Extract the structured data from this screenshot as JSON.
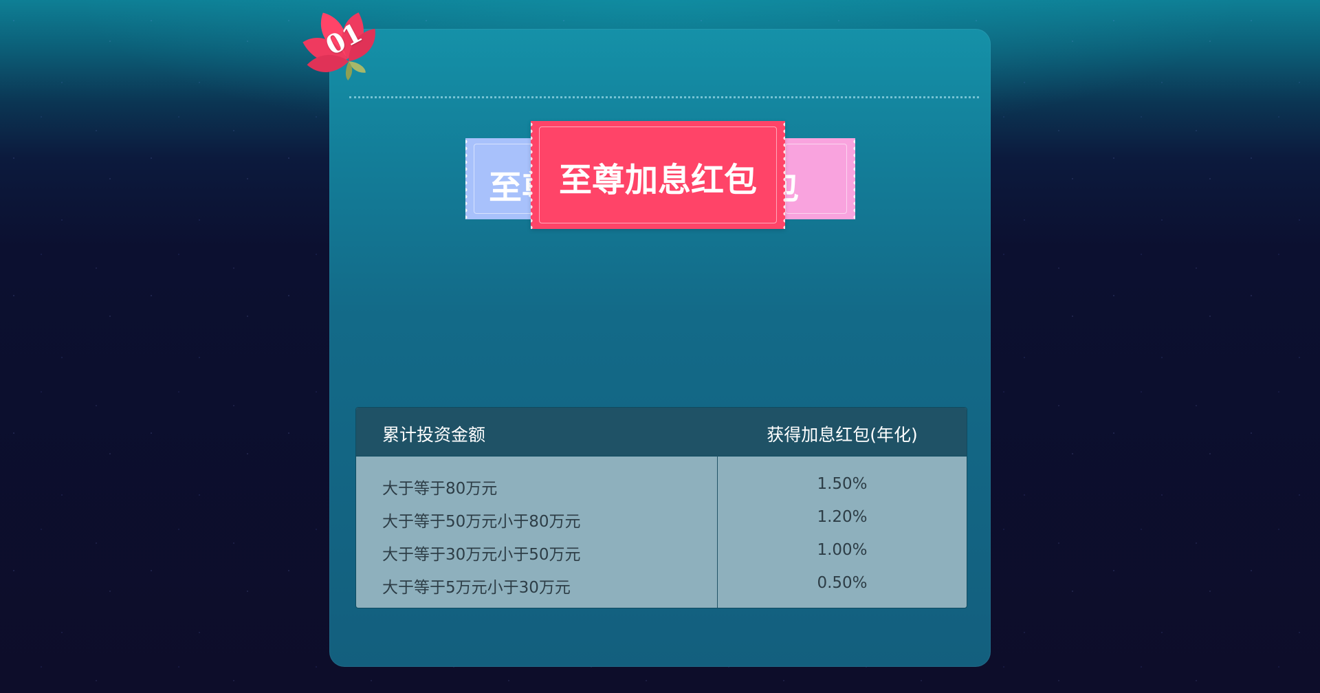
{
  "badge": {
    "number": "01"
  },
  "tickets": {
    "left_visible_text": "至尊",
    "main": "至尊加息红包",
    "right_visible_text": "红包"
  },
  "table": {
    "headers": [
      "累计投资金额",
      "获得加息红包(年化)"
    ],
    "rows": [
      {
        "amount": "大于等于80万元",
        "rate": "1.50%"
      },
      {
        "amount": "大于等于50万元小于80万元",
        "rate": "1.20%"
      },
      {
        "amount": "大于等于30万元小于50万元",
        "rate": "1.00%"
      },
      {
        "amount": "大于等于5万元小于30万元",
        "rate": "0.50%"
      }
    ]
  },
  "colors": {
    "ticket_main": "#ff4468",
    "ticket_left": "#a8c1fb",
    "ticket_right": "#f9a3de",
    "card": "#137e99",
    "table_header": "#1f5266"
  }
}
